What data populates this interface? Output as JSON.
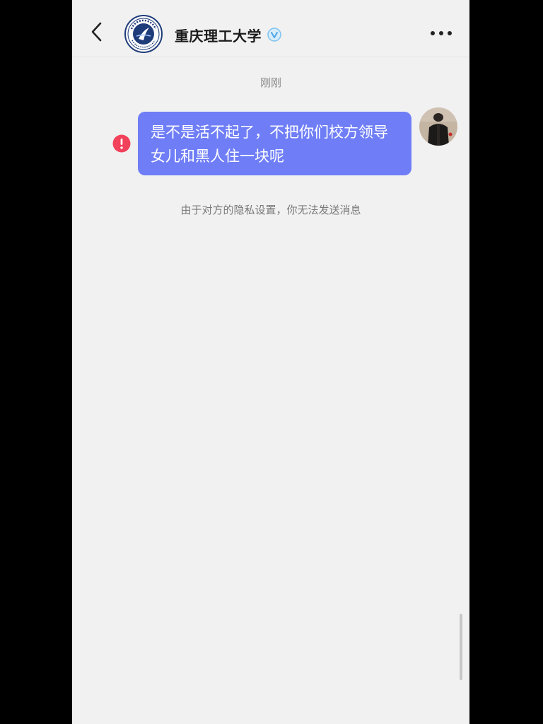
{
  "header": {
    "back_icon": "chevron-left-icon",
    "title": "重庆理工大学",
    "verified_icon": "verified-badge-icon",
    "more_icon": "more-horizontal-icon",
    "logo_icon": "university-logo-icon"
  },
  "chat": {
    "timestamp": "刚刚",
    "messages": [
      {
        "text": "是不是活不起了，不把你们校方领导女儿和黑人住一块呢",
        "status_icon": "error-icon"
      }
    ],
    "system_notice": "由于对方的隐私设置，你无法发送消息"
  },
  "colors": {
    "bubble": "#6f7ef6",
    "error": "#f2415a",
    "verified": "#7cc2f0",
    "background": "#f1f1f1"
  }
}
